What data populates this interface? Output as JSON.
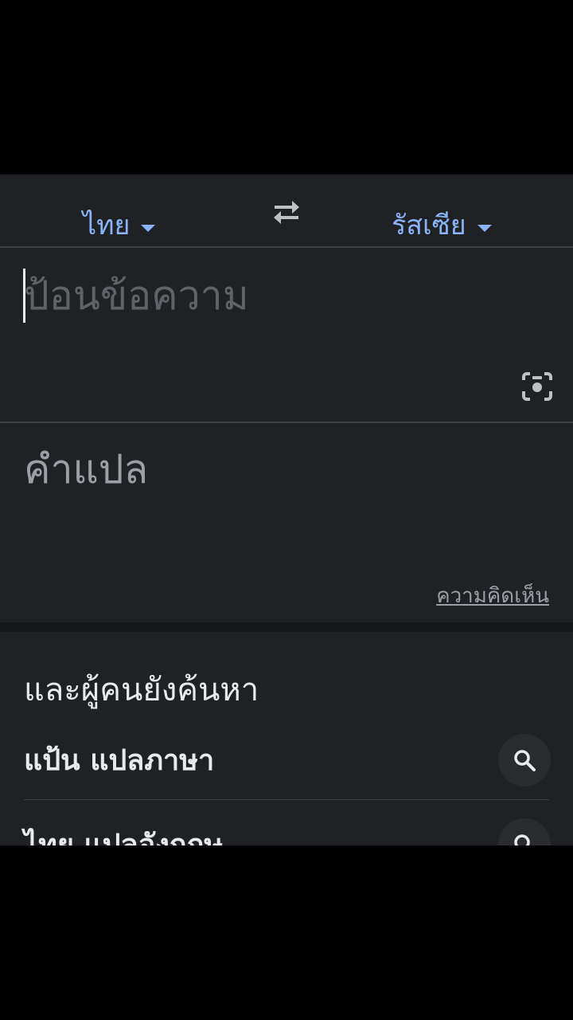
{
  "languages": {
    "source": "ไทย",
    "target": "รัสเซีย"
  },
  "input": {
    "placeholder": "ป้อนข้อความ"
  },
  "output": {
    "placeholder": "คำแปล",
    "feedback_label": "ความคิดเห็น"
  },
  "related": {
    "title": "และผู้คนยังค้นหา",
    "items": [
      {
        "label": "แป้น แปลภาษา"
      },
      {
        "label": "ไทย แปลอังกฤษ"
      }
    ]
  },
  "icons": {
    "swap": "swap-arrows-icon",
    "camera": "camera-lens-icon",
    "search": "search-icon",
    "dropdown": "chevron-down-icon"
  },
  "colors": {
    "background": "#202124",
    "accent": "#8ab4f8",
    "text": "#e8eaed",
    "muted": "#9aa0a6"
  }
}
